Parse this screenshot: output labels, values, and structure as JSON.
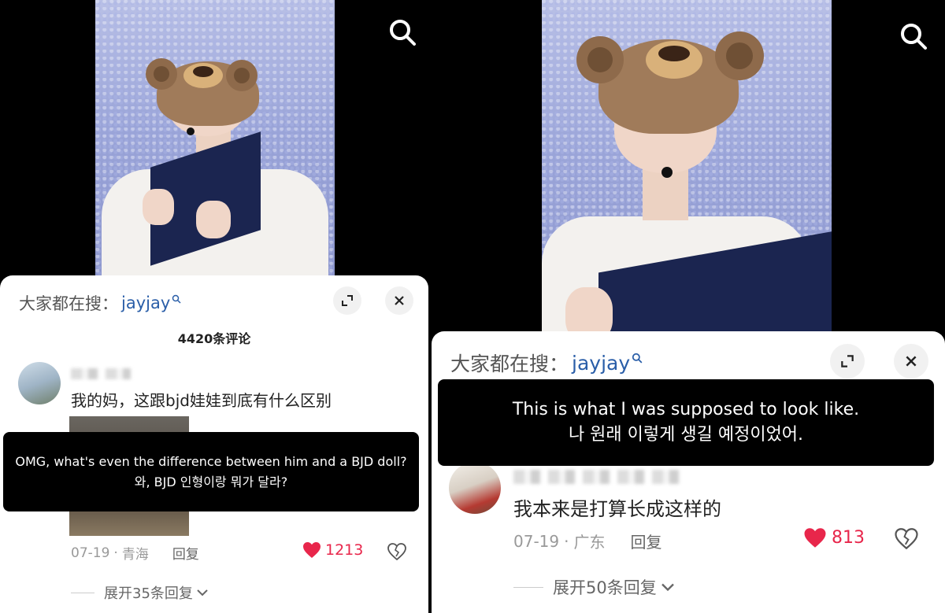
{
  "left": {
    "search_label": "大家都在搜：",
    "search_keyword": "jayjay",
    "comment_count": "4420条评论",
    "comment_text": "我的妈，这跟bjd娃娃到底有什么区别",
    "date": "07-19",
    "location": "青海",
    "reply_label": "回复",
    "likes": "1213",
    "expand_label": "展开35条回复",
    "caption_line1": "OMG, what's even the difference between him and a BJD doll?",
    "caption_line2": "와, BJD 인형이랑 뭐가 달라?"
  },
  "right": {
    "search_label": "大家都在搜：",
    "search_keyword": "jayjay",
    "comment_text": "我本来是打算长成这样的",
    "date": "07-19",
    "location": "广东",
    "reply_label": "回复",
    "likes": "813",
    "expand_label": "展开50条回复",
    "caption_line1": "This is what I was supposed to look like.",
    "caption_line2": "나 원래 이렇게 생길 예정이었어."
  },
  "colors": {
    "keyword": "#2a5ea8",
    "like": "#e8264b",
    "caption_bg": "#000000"
  },
  "icons": [
    "search-icon",
    "search-small-icon",
    "expand-icon",
    "close-icon",
    "heart-icon",
    "broken-heart-icon",
    "chevron-down-icon"
  ]
}
